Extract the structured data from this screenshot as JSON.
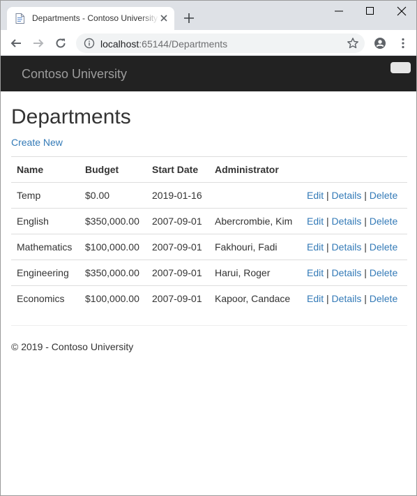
{
  "browser": {
    "tab_title": "Departments - Contoso University",
    "url_host": "localhost",
    "url_rest": ":65144/Departments"
  },
  "site": {
    "brand": "Contoso University"
  },
  "page": {
    "title": "Departments",
    "create_link": "Create New"
  },
  "table": {
    "headers": [
      "Name",
      "Budget",
      "Start Date",
      "Administrator"
    ],
    "rows": [
      {
        "name": "Temp",
        "budget": "$0.00",
        "start_date": "2019-01-16",
        "administrator": ""
      },
      {
        "name": "English",
        "budget": "$350,000.00",
        "start_date": "2007-09-01",
        "administrator": "Abercrombie, Kim"
      },
      {
        "name": "Mathematics",
        "budget": "$100,000.00",
        "start_date": "2007-09-01",
        "administrator": "Fakhouri, Fadi"
      },
      {
        "name": "Engineering",
        "budget": "$350,000.00",
        "start_date": "2007-09-01",
        "administrator": "Harui, Roger"
      },
      {
        "name": "Economics",
        "budget": "$100,000.00",
        "start_date": "2007-09-01",
        "administrator": "Kapoor, Candace"
      }
    ],
    "actions": {
      "edit": "Edit",
      "details": "Details",
      "delete": "Delete",
      "separator": "|"
    }
  },
  "footer": {
    "text": "© 2019 - Contoso University"
  },
  "colors": {
    "navbar": "#222222",
    "brand": "#9d9d9d",
    "link": "#337ab7",
    "tabstrip": "#dee1e6"
  }
}
